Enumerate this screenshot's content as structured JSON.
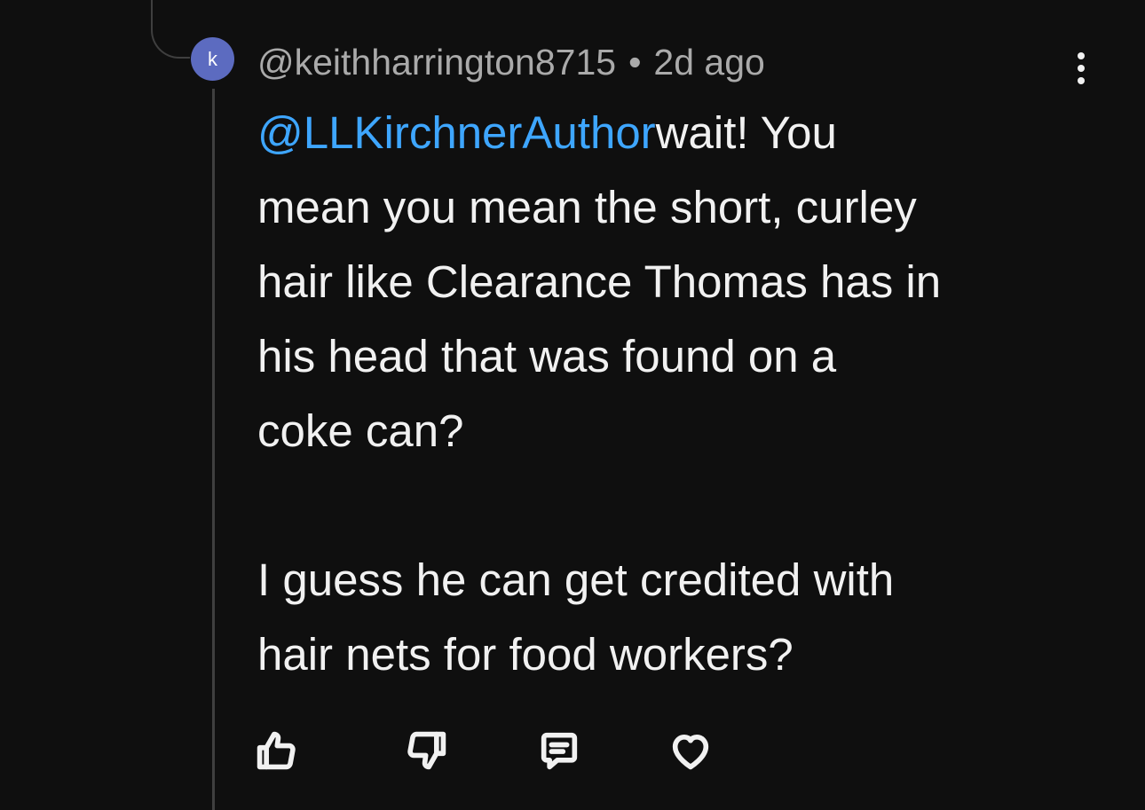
{
  "comment": {
    "avatar_letter": "k",
    "avatar_color": "#5c6bc0",
    "author": "@keithharrington8715",
    "separator": "•",
    "timestamp": "2d ago",
    "mention": "@LLKirchnerAuthor",
    "mention_color": "#3ea6ff",
    "paragraph1_lines": [
      "wait!  You",
      "mean you mean the short, curley",
      "hair like Clearance Thomas has in",
      "his head that was found on a",
      "coke can?"
    ],
    "paragraph2_lines": [
      "I guess he can get credited with",
      "hair nets for food workers?"
    ]
  },
  "actions": {
    "like_icon": "thumbs-up-icon",
    "dislike_icon": "thumbs-down-icon",
    "reply_icon": "reply-comment-icon",
    "heart_icon": "heart-icon"
  },
  "menu": {
    "icon": "more-vertical-icon"
  }
}
